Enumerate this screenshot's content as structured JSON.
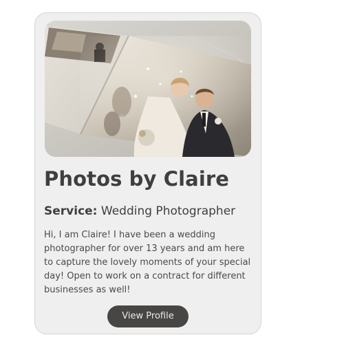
{
  "card": {
    "image_alt": "Wedding photo album showing a bride and groom surrounded by confetti",
    "title": "Photos by Claire",
    "service_label": "Service:",
    "service_value": "Wedding Photographer",
    "description": "Hi, I am Claire! I have been a wedding photographer for over 13 years and am here to capture the lovely moments of your special day! Open to work on a contract for different businesses as well!",
    "button_label": "View Profile"
  },
  "colors": {
    "card_background": "#efefef",
    "text": "#3f3f3f",
    "button_background": "#484644",
    "button_text": "#ececec"
  }
}
